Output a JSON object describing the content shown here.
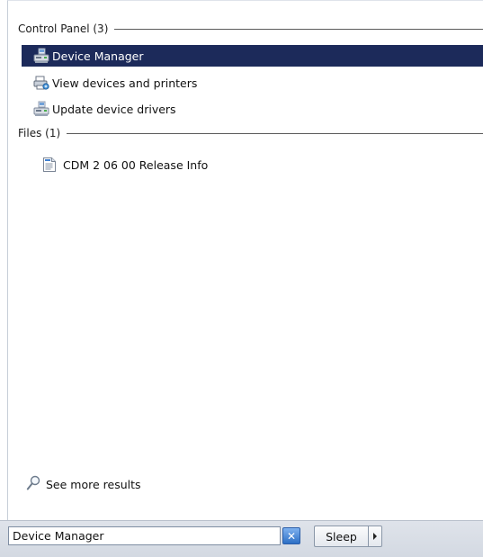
{
  "results": {
    "groups": [
      {
        "header": "Control Panel (3)",
        "items": [
          {
            "label": "Device Manager",
            "icon": "device-manager-icon",
            "selected": true
          },
          {
            "label": "View devices and printers",
            "icon": "devices-printers-icon",
            "selected": false
          },
          {
            "label": "Update device drivers",
            "icon": "device-drivers-icon",
            "selected": false
          }
        ]
      },
      {
        "header": "Files (1)",
        "items": [
          {
            "label": "CDM 2 06 00 Release Info",
            "icon": "text-document-icon",
            "selected": false
          }
        ]
      }
    ],
    "see_more": "See more results"
  },
  "search": {
    "value": "Device Manager"
  },
  "power": {
    "label": "Sleep"
  },
  "colors": {
    "selection": "#1c2a5a",
    "bottom_bar": "#dfe3ea"
  }
}
